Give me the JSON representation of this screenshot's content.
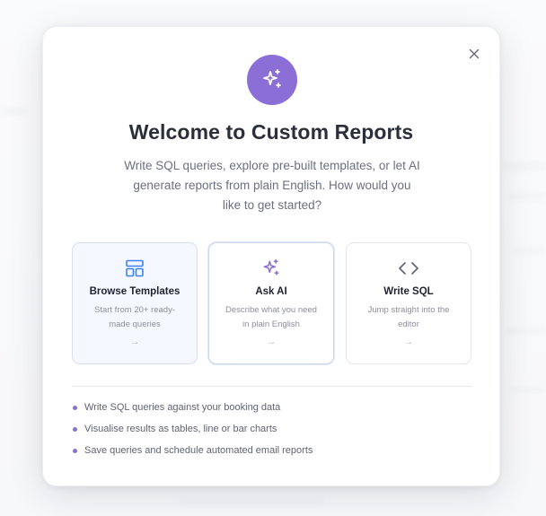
{
  "modal": {
    "title": "Welcome to Custom Reports",
    "subtitle": "Write SQL queries, explore pre-built templates, or let AI generate reports from plain English. How would you like to get started?",
    "close_icon": "close-icon",
    "hero_icon": "sparkles-icon"
  },
  "options": [
    {
      "title": "Browse Templates",
      "description": "Start from 20+ ready-made queries",
      "icon": "layout-template-icon",
      "arrow": "→"
    },
    {
      "title": "Ask AI",
      "description": "Describe what you need in plain English",
      "icon": "sparkles-icon",
      "arrow": "→"
    },
    {
      "title": "Write SQL",
      "description": "Jump straight into the editor",
      "icon": "code-icon",
      "arrow": "→"
    }
  ],
  "features": [
    "Write SQL queries against your booking data",
    "Visualise results as tables, line or bar charts",
    "Save queries and schedule automated email reports"
  ],
  "colors": {
    "accent": "#8b6fd6",
    "blue_icon": "#3b82f6",
    "title": "#2b2f3a",
    "body": "#6b7080"
  }
}
